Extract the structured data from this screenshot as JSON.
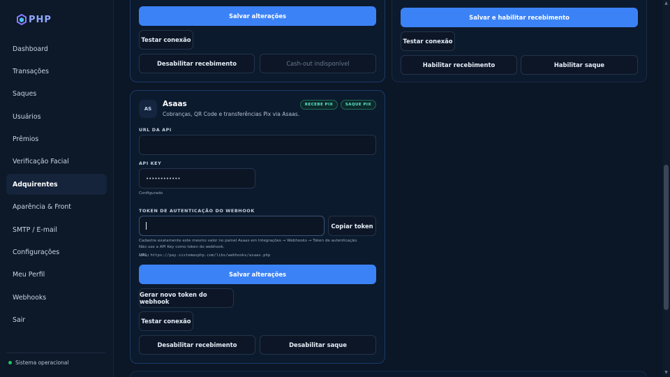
{
  "brand": {
    "name": "PHP"
  },
  "sidebar": {
    "items": [
      {
        "label": "Dashboard"
      },
      {
        "label": "Transações"
      },
      {
        "label": "Saques"
      },
      {
        "label": "Usuários"
      },
      {
        "label": "Prêmios"
      },
      {
        "label": "Verificação Facial"
      },
      {
        "label": "Adquirentes"
      },
      {
        "label": "Aparência & Front"
      },
      {
        "label": "SMTP / E-mail"
      },
      {
        "label": "Configurações"
      },
      {
        "label": "Meu Perfil"
      },
      {
        "label": "Webhooks"
      },
      {
        "label": "Sair"
      }
    ],
    "active_index": 6,
    "status": "Sistema operacional"
  },
  "top_left_card": {
    "save_label": "Salvar alterações",
    "test_label": "Testar conexão",
    "disable_receive_label": "Desabilitar recebimento",
    "cashout_label": "Cash-out indisponível"
  },
  "top_right_card": {
    "save_enable_label": "Salvar e habilitar recebimento",
    "test_label": "Testar conexão",
    "enable_receive_label": "Habilitar recebimento",
    "enable_withdraw_label": "Habilitar saque"
  },
  "asaas": {
    "avatar": "AS",
    "title": "Asaas",
    "description": "Cobranças, QR Code e transferências Pix via Asaas.",
    "badges": [
      "RECEBE PIX",
      "SAQUE PIX"
    ],
    "api_url_label": "URL DA API",
    "api_url_value": "",
    "api_key_label": "API KEY",
    "api_key_value": "••••••••••••",
    "api_key_status": "Configurado",
    "webhook_token_label": "TOKEN DE AUTENTICAÇÃO DO WEBHOOK",
    "webhook_token_value": "",
    "copy_token_label": "Copiar token",
    "help_line1": "Cadastre exatamente este mesmo valor no painel Asaas em Integrações → Webhooks → Token de autenticação.",
    "help_line2": "Não use a API Key como token do webhook.",
    "url_prefix": "URL:",
    "url_value": "https://pay.sistemasphp.com/libs/webhooks/asaas.php",
    "save_label": "Salvar alterações",
    "new_token_label": "Gerar novo token do webhook",
    "test_label": "Testar conexão",
    "disable_receive_label": "Desabilitar recebimento",
    "disable_withdraw_label": "Desabilitar saque"
  },
  "colors": {
    "accent": "#3b82f6",
    "badge": "#5eead4",
    "status": "#22c55e"
  }
}
